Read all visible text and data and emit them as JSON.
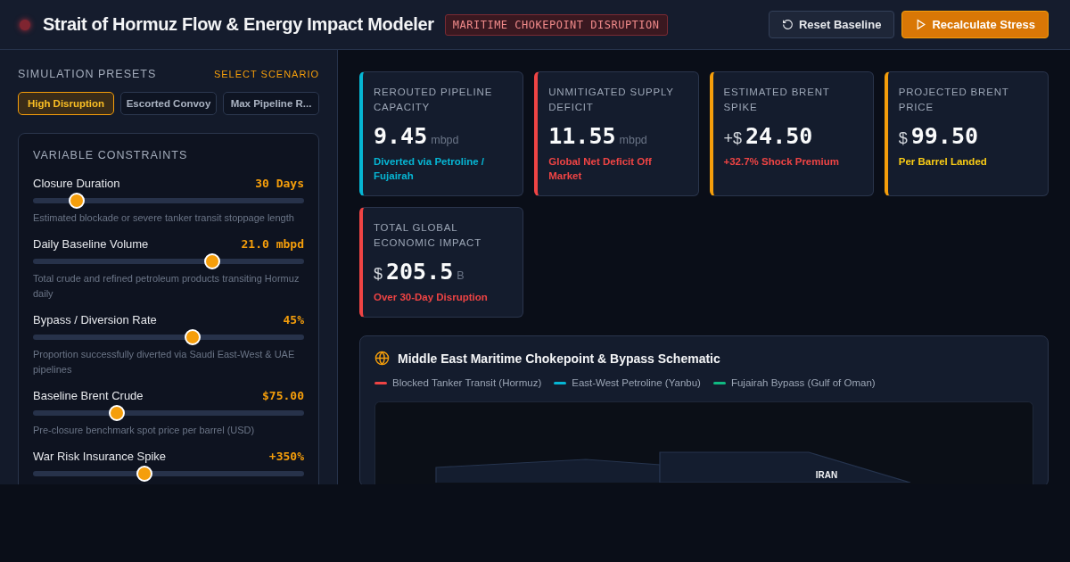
{
  "header": {
    "title": "Strait of Hormuz Flow & Energy Impact Modeler",
    "badge": "MARITIME CHOKEPOINT DISRUPTION",
    "buttons": [
      {
        "label": "Reset Baseline",
        "kind": "secondary"
      },
      {
        "label": "Recalculate Stress",
        "kind": "primary"
      }
    ]
  },
  "presets": {
    "title": "SIMULATION PRESETS",
    "action": "SELECT SCENARIO",
    "items": [
      {
        "label": "High Disruption",
        "selected": true
      },
      {
        "label": "Escorted Convoy",
        "selected": false
      },
      {
        "label": "Max Pipeline R...",
        "selected": false
      }
    ]
  },
  "constraints": {
    "title": "VARIABLE CONSTRAINTS",
    "sliders": [
      {
        "label": "Closure Duration",
        "reading": "30 Days",
        "level": 0.16,
        "hint": "Estimated blockade or severe tanker transit stoppage length"
      },
      {
        "label": "Daily Baseline Volume",
        "reading": "21.0 mbpd",
        "level": 0.66,
        "hint": "Total crude and refined petroleum products transiting Hormuz daily"
      },
      {
        "label": "Bypass / Diversion Rate",
        "reading": "45%",
        "level": 0.59,
        "hint": "Proportion successfully diverted via Saudi East-West & UAE pipelines"
      },
      {
        "label": "Baseline Brent Crude",
        "reading": "$75.00",
        "level": 0.31,
        "hint": "Pre-closure benchmark spot price per barrel (USD)"
      },
      {
        "label": "War Risk Insurance Spike",
        "reading": "+350%",
        "level": 0.41
      }
    ]
  },
  "metrics": [
    {
      "title": "REROUTED PIPELINE CAPACITY",
      "value": "9.45",
      "unit": "mbpd",
      "note": {
        "text": "Diverted via Petroline / Fujairah",
        "color": "#06b6d4"
      },
      "color": "#06b6d4"
    },
    {
      "title": "UNMITIGATED SUPPLY DEFICIT",
      "value": "11.55",
      "unit": "mbpd",
      "note": {
        "text": "Global Net Deficit Off Market",
        "color": "#ef4444"
      },
      "color": "#ef4444"
    },
    {
      "title": "ESTIMATED BRENT SPIKE",
      "prefix": "+$",
      "value": "24.50",
      "note": {
        "text": "+32.7% Shock Premium",
        "color": "#ef4444"
      },
      "color": "#f59e0b"
    },
    {
      "title": "PROJECTED BRENT PRICE",
      "prefix": "$",
      "value": "99.50",
      "note": {
        "text": "Per Barrel Landed",
        "color": "#facc15"
      },
      "color": "#f59e0b"
    },
    {
      "title": "TOTAL GLOBAL ECONOMIC IMPACT",
      "prefix": "$",
      "value": "205.5",
      "unit": "B",
      "note": {
        "text": "Over 30-Day Disruption",
        "color": "#ef4444"
      },
      "color": "#ef4444"
    }
  ],
  "schematic": {
    "title": "Middle East Maritime Chokepoint & Bypass Schematic",
    "legend": [
      {
        "label": "Blocked Tanker Transit (Hormuz)",
        "color": "#ef4444"
      },
      {
        "label": "East-West Petroline (Yanbu)",
        "color": "#06b6d4"
      },
      {
        "label": "Fujairah Bypass (Gulf of Oman)",
        "color": "#10b981"
      }
    ],
    "map_labels": [
      "IRAN"
    ]
  }
}
